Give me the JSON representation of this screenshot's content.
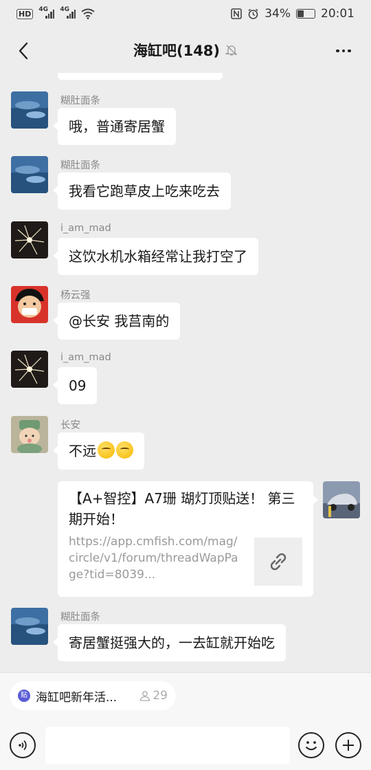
{
  "status_bar": {
    "hd_label": "HD",
    "network_1": "4G",
    "network_2": "4G",
    "battery_percent": "34%",
    "battery_level": 0.34,
    "time": "20:01"
  },
  "header": {
    "title": "海缸吧(148)"
  },
  "messages": [
    {
      "sender": "糊肚面条",
      "text": "哦，普通寄居蟹"
    },
    {
      "sender": "糊肚面条",
      "text": "我看它跑草皮上吃来吃去"
    },
    {
      "sender": "i_am_mad",
      "text": "这饮水机水箱经常让我打空了"
    },
    {
      "sender": "杨云强",
      "text": "@长安  我莒南的"
    },
    {
      "sender": "i_am_mad",
      "text": "09"
    },
    {
      "sender": "长安",
      "text": "不远"
    },
    {
      "sender": "糊肚面条",
      "text": "寄居蟹挺强大的，一去缸就开始吃"
    }
  ],
  "link_card": {
    "title": "【A+智控】A7珊 瑚灯顶贴送！ 第三期开始！",
    "url": "https://app.cmfish.com/mag/circle/v1/forum/threadWapPage?tid=8039..."
  },
  "bottom": {
    "topic_icon_text": "贴",
    "topic_label": "海缸吧新年活...",
    "topic_count": "29",
    "input_value": ""
  },
  "colors": {
    "background": "#ededed",
    "bubble": "#ffffff",
    "sender_name": "#888888",
    "link_url": "#9a9a9a"
  }
}
